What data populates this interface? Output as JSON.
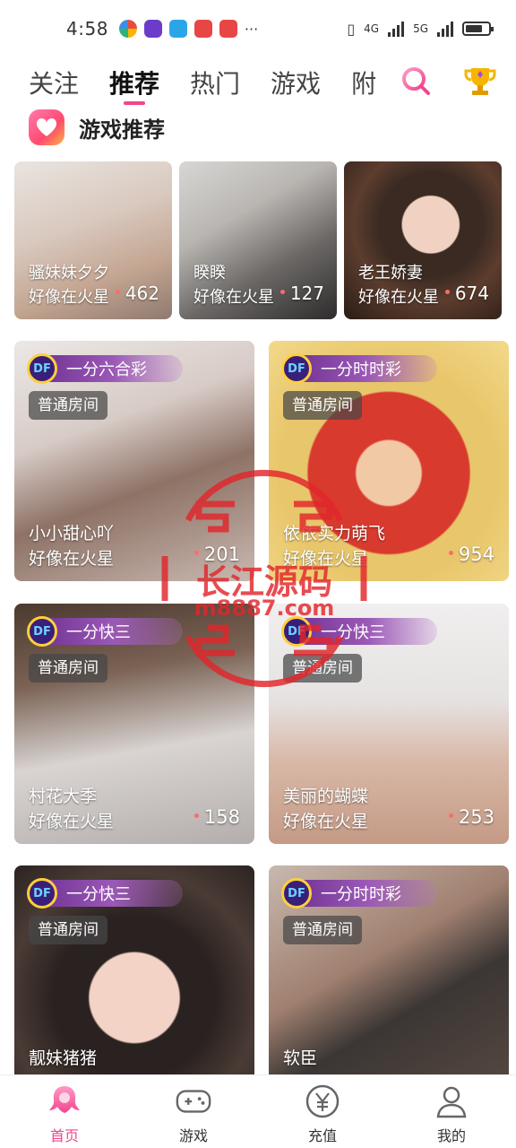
{
  "status_bar": {
    "time": "4:58",
    "network_1": "4G",
    "network_2": "5G"
  },
  "top_nav": {
    "tabs": [
      "关注",
      "推荐",
      "热门",
      "游戏",
      "附"
    ],
    "active_tab": "推荐"
  },
  "section": {
    "title": "游戏推荐"
  },
  "small_cards": [
    {
      "name": "骚妹妹夕夕",
      "location": "好像在火星",
      "count": "462"
    },
    {
      "name": "睽睽",
      "location": "好像在火星",
      "count": "127"
    },
    {
      "name": "老王娇妻",
      "location": "好像在火星",
      "count": "674"
    }
  ],
  "room_cards": [
    {
      "game": "一分六合彩",
      "room_type": "普通房间",
      "name": "小小甜心吖",
      "location": "好像在火星",
      "count": "201"
    },
    {
      "game": "一分时时彩",
      "room_type": "普通房间",
      "name": "依依实力萌飞",
      "location": "好像在火星",
      "count": "954"
    },
    {
      "game": "一分快三",
      "room_type": "普通房间",
      "name": "村花大季",
      "location": "好像在火星",
      "count": "158"
    },
    {
      "game": "一分快三",
      "room_type": "普通房间",
      "name": "美丽的蝴蝶",
      "location": "好像在火星",
      "count": "253"
    },
    {
      "game": "一分快三",
      "room_type": "普通房间",
      "name": "靓妹猪猪",
      "location": "",
      "count": ""
    },
    {
      "game": "一分时时彩",
      "room_type": "普通房间",
      "name": "软臣",
      "location": "",
      "count": ""
    }
  ],
  "watermark": {
    "text": "长江源码",
    "url": "m8887.com"
  },
  "bottom_nav": {
    "items": [
      "首页",
      "游戏",
      "充值",
      "我的"
    ],
    "active": "首页"
  },
  "colors": {
    "accent": "#f2458d",
    "tag_purple": "#6a2d8f",
    "watermark_red": "#e2262b"
  },
  "icons": {
    "search": "search-icon",
    "trophy": "trophy-icon",
    "section": "heart-icon",
    "home": "home-icon",
    "game": "gamepad-icon",
    "recharge": "yuan-icon",
    "profile": "user-icon"
  }
}
